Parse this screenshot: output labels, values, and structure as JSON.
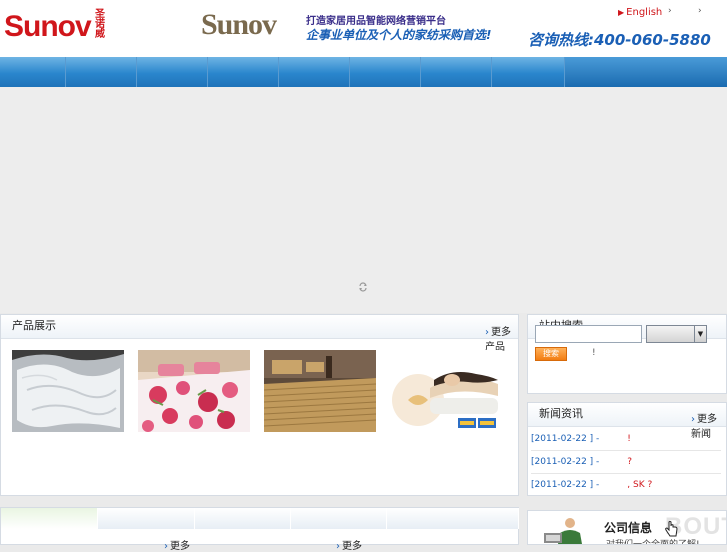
{
  "header": {
    "logo_text": "Sunov",
    "logo_cn": "圣诺威",
    "slogan_logo": "Sunov",
    "slogan_line1": "打造家居用品智能网络营销平台",
    "slogan_line2": "企事业单位及个人的家纺采购首选!",
    "lang_english": "English",
    "lang_2": "",
    "lang_3": "",
    "hotline": "咨询热线:400-060-5880"
  },
  "products_panel": {
    "title": "产品展示",
    "more": "更多产品",
    "items": [
      {
        "name": "white-duvet"
      },
      {
        "name": "floral-bedding"
      },
      {
        "name": "bamboo-mat"
      },
      {
        "name": "memory-pillow"
      }
    ]
  },
  "search_panel": {
    "title": "站内搜索",
    "input_value": "",
    "select_value": "",
    "button_label": "搜索",
    "note": "!"
  },
  "news_panel": {
    "title": "新闻资讯",
    "more": "更多新闻",
    "items": [
      {
        "date": "[2011-02-22 ] -",
        "text": "!"
      },
      {
        "date": "[2011-02-22 ] -",
        "text": "?"
      },
      {
        "date": "[2011-02-22 ] -",
        "text": ", SK ?"
      }
    ]
  },
  "tabs": {
    "links": [
      "更多",
      "更多"
    ]
  },
  "info_box": {
    "title": "公司信息",
    "subtitle": "对我们一个全面的了解!",
    "watermark": "BOUT"
  },
  "colors": {
    "brand_red": "#d0161b",
    "nav_blue": "#2a86cd",
    "link_blue": "#1a5fb5"
  }
}
